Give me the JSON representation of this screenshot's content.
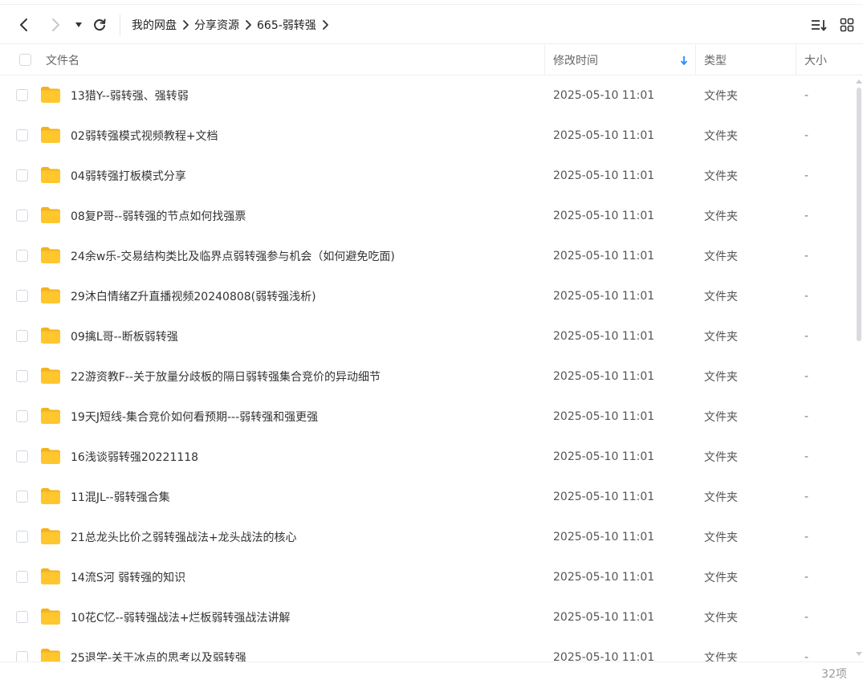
{
  "toolbar": {
    "back_icon": "chevron-left-icon",
    "forward_icon": "chevron-right-icon",
    "history_icon": "caret-down-icon",
    "refresh_icon": "refresh-icon",
    "sort_icon": "sort-icon",
    "grid_icon": "grid-view-icon"
  },
  "breadcrumb": {
    "items": [
      "我的网盘",
      "分享资源",
      "665-弱转强"
    ]
  },
  "columns": {
    "name": "文件名",
    "modified": "修改时间",
    "type": "类型",
    "size": "大小"
  },
  "colors": {
    "folder": "#FFC62E",
    "folder_tab": "#F5B21B",
    "sort_arrow": "#2F8BF2"
  },
  "files": [
    {
      "name": "13猎Y--弱转强、强转弱",
      "modified": "2025-05-10 11:01",
      "type": "文件夹",
      "size": "-"
    },
    {
      "name": "02弱转强模式视频教程+文档",
      "modified": "2025-05-10 11:01",
      "type": "文件夹",
      "size": "-"
    },
    {
      "name": "04弱转强打板模式分享",
      "modified": "2025-05-10 11:01",
      "type": "文件夹",
      "size": "-"
    },
    {
      "name": "08复P哥--弱转强的节点如何找强票",
      "modified": "2025-05-10 11:01",
      "type": "文件夹",
      "size": "-"
    },
    {
      "name": "24余w乐-交易结构类比及临界点弱转强参与机会（如何避免吃面)",
      "modified": "2025-05-10 11:01",
      "type": "文件夹",
      "size": "-"
    },
    {
      "name": "29沐白情绪Z升直播视频20240808(弱转强浅析)",
      "modified": "2025-05-10 11:01",
      "type": "文件夹",
      "size": "-"
    },
    {
      "name": "09擒L哥--断板弱转强",
      "modified": "2025-05-10 11:01",
      "type": "文件夹",
      "size": "-"
    },
    {
      "name": "22游资教F--关于放量分歧板的隔日弱转强集合竞价的异动细节",
      "modified": "2025-05-10 11:01",
      "type": "文件夹",
      "size": "-"
    },
    {
      "name": "19天J短线-集合竞价如何看预期---弱转强和强更强",
      "modified": "2025-05-10 11:01",
      "type": "文件夹",
      "size": "-"
    },
    {
      "name": "16浅谈弱转强20221118",
      "modified": "2025-05-10 11:01",
      "type": "文件夹",
      "size": "-"
    },
    {
      "name": "11混JL--弱转强合集",
      "modified": "2025-05-10 11:01",
      "type": "文件夹",
      "size": "-"
    },
    {
      "name": "21总龙头比价之弱转强战法+龙头战法的核心",
      "modified": "2025-05-10 11:01",
      "type": "文件夹",
      "size": "-"
    },
    {
      "name": "14流S河 弱转强的知识",
      "modified": "2025-05-10 11:01",
      "type": "文件夹",
      "size": "-"
    },
    {
      "name": "10花C忆--弱转强战法+烂板弱转强战法讲解",
      "modified": "2025-05-10 11:01",
      "type": "文件夹",
      "size": "-"
    },
    {
      "name": "25退学-关于冰点的思考以及弱转强",
      "modified": "2025-05-10 11:01",
      "type": "文件夹",
      "size": "-"
    }
  ],
  "footer": {
    "count": "32项"
  }
}
